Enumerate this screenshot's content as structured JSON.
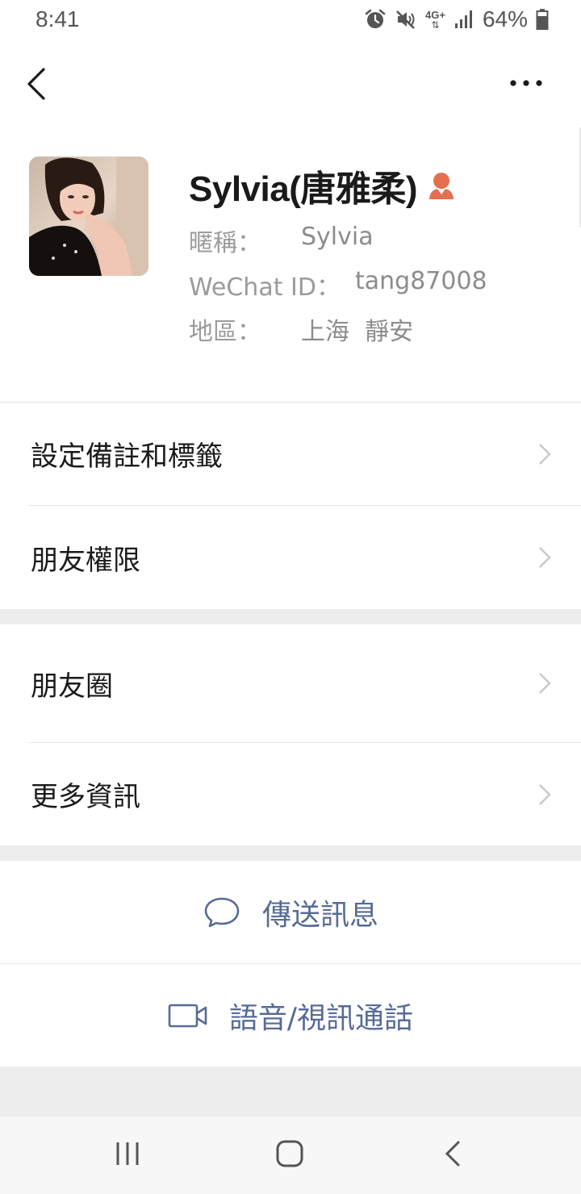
{
  "status_bar": {
    "time": "8:41",
    "network": "4G+",
    "battery": "64%"
  },
  "profile": {
    "name": "Sylvia(唐雅柔)",
    "nickname_label": "暱稱：",
    "nickname": "Sylvia",
    "wechat_id_label": "WeChat ID：",
    "wechat_id": "tang87008",
    "region_label": "地區：",
    "region": "上海  靜安"
  },
  "menu": {
    "set_remarks": "設定備註和標籤",
    "friend_permissions": "朋友權限",
    "moments": "朋友圈",
    "more_info": "更多資訊"
  },
  "actions": {
    "send_message": "傳送訊息",
    "voice_video_call": "語音/視訊通話"
  },
  "colors": {
    "link": "#576b95",
    "gender_icon": "#e4704f",
    "divider": "#ededed"
  }
}
